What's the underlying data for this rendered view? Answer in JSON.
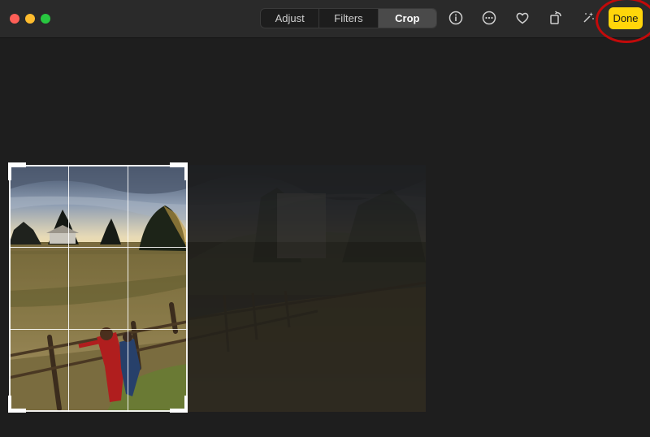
{
  "toolbar": {
    "segments": [
      {
        "label": "Adjust",
        "active": false
      },
      {
        "label": "Filters",
        "active": false
      },
      {
        "label": "Crop",
        "active": true
      }
    ],
    "icons": [
      "info-icon",
      "more-icon",
      "heart-icon",
      "rotate-icon",
      "magic-wand-icon"
    ],
    "done_label": "Done"
  },
  "colors": {
    "done": "#ffd60a",
    "annotation": "#c20a0a"
  }
}
